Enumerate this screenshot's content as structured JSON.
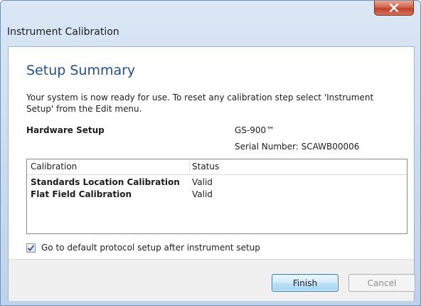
{
  "window": {
    "title": "Instrument Calibration",
    "close_glyph": "X"
  },
  "summary": {
    "heading": "Setup Summary",
    "intro": "Your system is now ready for use. To reset any calibration step select 'Instrument Setup' from the Edit menu."
  },
  "hardware": {
    "label": "Hardware Setup",
    "model": "GS-900™",
    "serial": "Serial Number: SCAWB00006"
  },
  "table": {
    "headers": [
      "Calibration",
      "Status"
    ],
    "rows": [
      {
        "name": "Standards Location Calibration",
        "status": "Valid"
      },
      {
        "name": "Flat Field Calibration",
        "status": "Valid"
      }
    ]
  },
  "options": {
    "checkbox_label": "Go to default protocol setup after instrument setup",
    "checked": true
  },
  "buttons": {
    "finish": "Finish",
    "cancel": "Cancel"
  },
  "colors": {
    "heading": "#1f4f93",
    "close_button": "#c1402a",
    "check_mark": "#2b5ea8"
  }
}
